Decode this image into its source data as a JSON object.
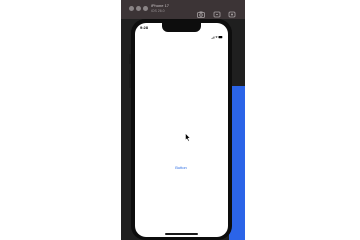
{
  "simulator": {
    "device_name": "iPhone 17",
    "os_version": "iOS 26.0",
    "toolbar_icons": [
      "screenshot-icon",
      "rotate-icon",
      "home-icon"
    ]
  },
  "status_bar": {
    "time": "9:28"
  },
  "app": {
    "button_label": "Button"
  },
  "colors": {
    "accent": "#2f6fe4",
    "backdrop": "#2b64e8",
    "titlebar": "#3c3436"
  }
}
